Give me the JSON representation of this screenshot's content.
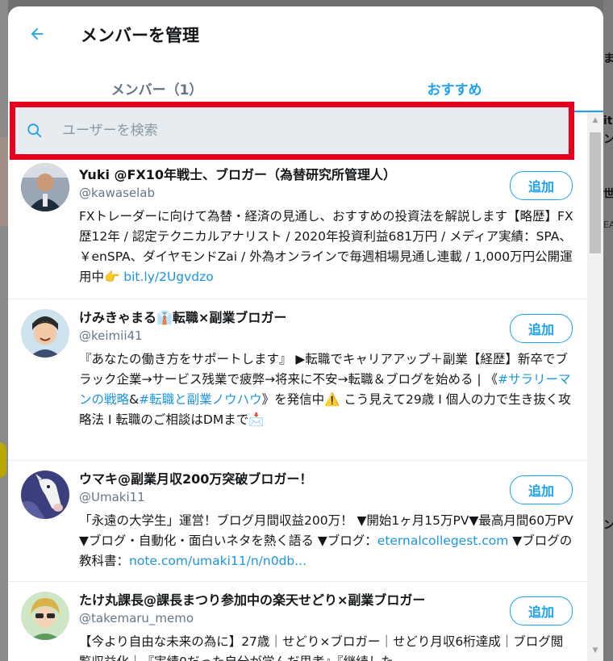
{
  "modal": {
    "title": "メンバーを管理",
    "tabs": [
      {
        "label": "メンバー（1）",
        "active": false
      },
      {
        "label": "おすすめ",
        "active": true
      }
    ]
  },
  "search": {
    "placeholder": "ユーザーを検索"
  },
  "users": [
    {
      "name": "Yuki @FX10年戦士、ブロガー（為替研究所管理人）",
      "handle": "@kawaselab",
      "add_label": "追加",
      "bio_parts": [
        "FXトレーダーに向けて為替・経済の見通し、おすすめの投資法を解説します【略歴】FX歴12年 / 認定テクニカルアナリスト / 2020年投資利益681万円 / メディア実績：SPA、￥enSPA、ダイヤモンドZai / 外為オンラインで毎週相場見通し連載 / 1,000万円公開運用中👉 "
      ],
      "bio_link": "bit.ly/2Ugvdzo"
    },
    {
      "name": "けみきゃまる👔転職×副業ブロガー",
      "handle": "@keimii41",
      "add_label": "追加",
      "bio_a": "『あなたの働き方をサポートします』 ▶転職でキャリアアップ＋副業【経歴】新卒でブラック企業→サービス残業で疲弊→将来に不安→転職＆ブログを始める | 《",
      "tag1": "#サラリーマンの戦略",
      "bio_b": "&",
      "tag2": "#転職と副業ノウハウ",
      "bio_c": "》を発信中⚠️ こう見えて29歳 I 個人の力で生き抜く攻略法 I 転職のご相談はDMまで📩"
    },
    {
      "name": "ウマキ@副業月収200万突破ブロガー！",
      "handle": "@Umaki11",
      "add_label": "追加",
      "bio_a": "「永遠の大学生」運営！ブログ月間収益200万！ ▼開始1ヶ月15万PV▼最高月間60万PV ▼ブログ・自動化・面白いネタを熱く語る ▼ブログ：",
      "link1": "eternalcollegest.com",
      "bio_b": " ▼ブログの教科書：",
      "link2": "note.com/umaki11/n/n0db..."
    },
    {
      "name": "たけ丸課長@課長まつり参加中の楽天せどり×副業ブロガー",
      "handle": "@takemaru_memo",
      "add_label": "追加",
      "bio": "【今より自由な未来の為に】27歳｜せどり×ブロガー｜せどり月収6桁達成｜ブログ閲覧収益化｜『実績0だった自分が学んだ思考』『継続した"
    }
  ],
  "colors": {
    "accent": "#1da1f2",
    "highlight": "#e6001d",
    "search_bg": "#e6ecf0"
  },
  "background": {
    "right_texts": [
      "ま",
      "it",
      "ン",
      "世界",
      "EA",
      "ン"
    ]
  }
}
